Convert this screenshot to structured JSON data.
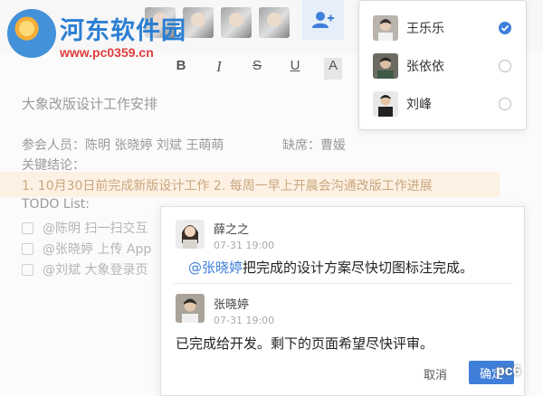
{
  "watermark": {
    "site_name": "河东软件园",
    "url": "www.pc0359.cn"
  },
  "toolbar": {
    "format": {
      "bold": "B",
      "italic": "I",
      "strike": "S",
      "underline": "U",
      "text_color": "A"
    }
  },
  "document": {
    "title": "大象改版设计工作安排",
    "attendees_line": "参会人员：陈明 张晓婷 刘斌 王萌萌",
    "absent_line": "缺席：曹媛",
    "conclusion_label": "关键结论：",
    "conclusion_text": "1. 10月30日前完成新版设计工作    2. 每周一早上开晨会沟通改版工作进展",
    "todo_label": "TODO List:",
    "todos": [
      "@陈明 扫一扫交互",
      "@张晓婷 上传 App",
      "@刘斌 大象登录页"
    ]
  },
  "mention_menu": {
    "items": [
      {
        "name": "王乐乐",
        "checked": true
      },
      {
        "name": "张依依",
        "checked": false
      },
      {
        "name": "刘峰",
        "checked": false
      }
    ]
  },
  "comments": {
    "items": [
      {
        "author": "薛之之",
        "time": "07-31 19:00",
        "mention": "@张晓婷",
        "text": "把完成的设计方案尽快切图标注完成。"
      },
      {
        "author": "张晓婷",
        "time": "07-31 19:00",
        "mention": "",
        "text": "已完成给开发。剩下的页面希望尽快评审。"
      }
    ],
    "cancel_label": "取消",
    "ok_label": "确定"
  },
  "corner_badge": "pc6",
  "colors": {
    "accent": "#3f7fd9",
    "highlight_bg": "#fdf1e4"
  }
}
